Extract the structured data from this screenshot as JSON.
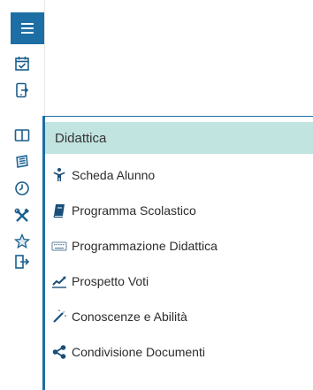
{
  "sidebar": {
    "icons": [
      {
        "name": "menu-icon"
      },
      {
        "name": "calendar-check-icon"
      },
      {
        "name": "mobile-export-icon"
      },
      {
        "name": "open-book-icon"
      },
      {
        "name": "newspaper-icon"
      },
      {
        "name": "clock-icon"
      },
      {
        "name": "tools-icon"
      },
      {
        "name": "star-outline-icon"
      },
      {
        "name": "sign-out-icon"
      }
    ]
  },
  "flyout": {
    "header": "Didattica",
    "items": [
      {
        "label": "Scheda Alunno",
        "icon": "child-icon"
      },
      {
        "label": "Programma Scolastico",
        "icon": "book-icon"
      },
      {
        "label": "Programmazione Didattica",
        "icon": "keyboard-icon"
      },
      {
        "label": "Prospetto Voti",
        "icon": "line-chart-icon"
      },
      {
        "label": "Conoscenze e Abilità",
        "icon": "magic-wand-icon"
      },
      {
        "label": "Condivisione Documenti",
        "icon": "share-icon"
      }
    ]
  },
  "colors": {
    "accent": "#1c6ea4",
    "header_bg": "#c2e4e1",
    "icon": "#1a5f8e"
  }
}
